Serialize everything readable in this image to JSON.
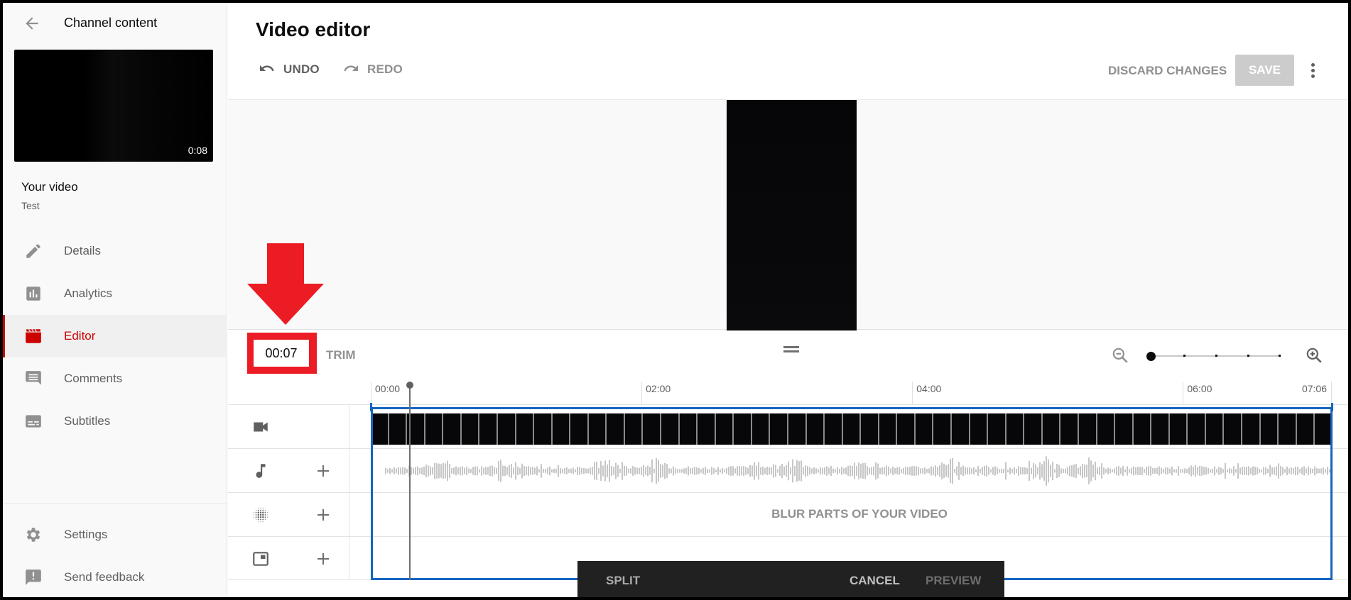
{
  "sidebar": {
    "back_label": "Channel content",
    "thumbnail_duration": "0:08",
    "your_video_label": "Your video",
    "video_title": "Test",
    "items": [
      {
        "label": "Details",
        "icon": "pencil-icon",
        "active": false
      },
      {
        "label": "Analytics",
        "icon": "analytics-icon",
        "active": false
      },
      {
        "label": "Editor",
        "icon": "clapperboard-icon",
        "active": true
      },
      {
        "label": "Comments",
        "icon": "comment-icon",
        "active": false
      },
      {
        "label": "Subtitles",
        "icon": "subtitles-icon",
        "active": false
      }
    ],
    "bottom_items": [
      {
        "label": "Settings",
        "icon": "gear-icon"
      },
      {
        "label": "Send feedback",
        "icon": "feedback-icon"
      }
    ]
  },
  "header": {
    "title": "Video editor",
    "undo_label": "UNDO",
    "redo_label": "REDO",
    "discard_label": "DISCARD CHANGES",
    "save_label": "SAVE"
  },
  "timeline": {
    "current_time": "00:07",
    "trim_label": "TRIM",
    "zoom_level_index": 0,
    "zoom_steps": 5,
    "ruler_ticks": [
      "00:00",
      "02:00",
      "04:00",
      "06:00",
      "07:06"
    ],
    "blur_label": "BLUR PARTS OF YOUR VIDEO",
    "film_frames": 53
  },
  "action_bar": {
    "split_label": "SPLIT",
    "cancel_label": "CANCEL",
    "preview_label": "PREVIEW"
  },
  "colors": {
    "accent_red": "#cc0000",
    "selection_blue": "#1565c0",
    "annotation_red": "#ec1c24",
    "save_disabled": "#cccccc"
  }
}
